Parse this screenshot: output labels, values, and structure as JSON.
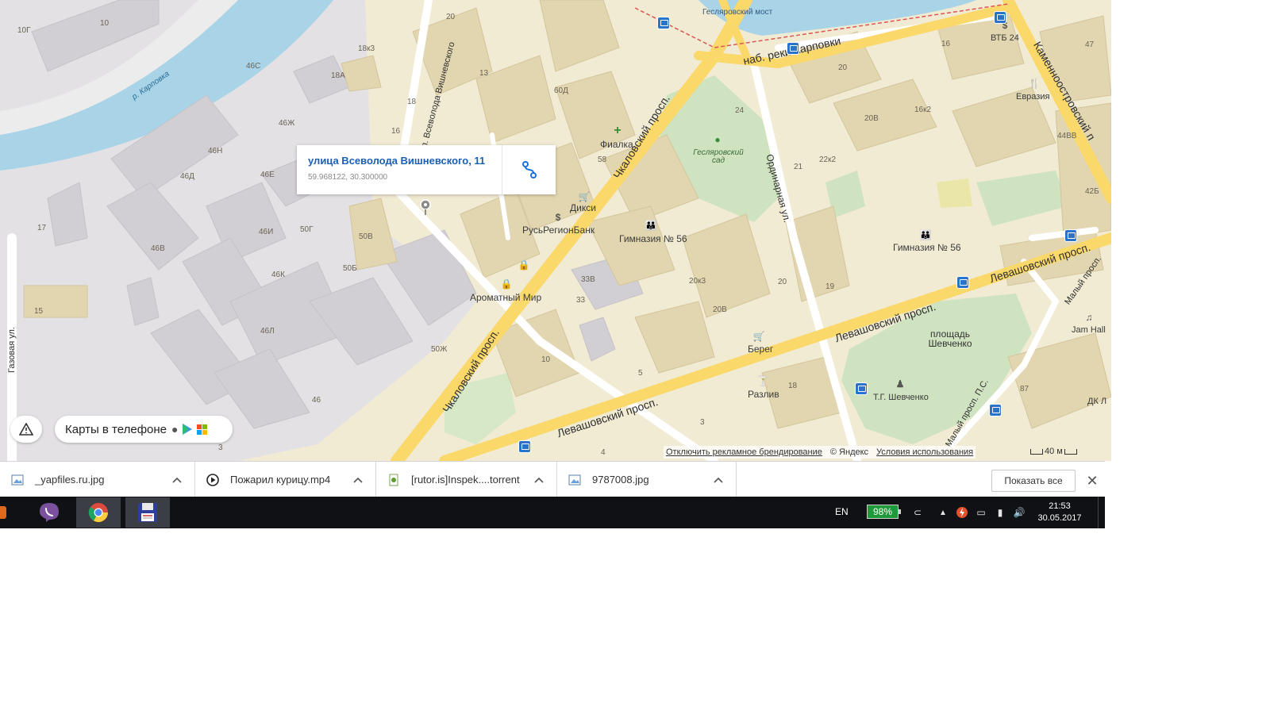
{
  "map": {
    "popup": {
      "address": "улица Всеволода Вишневского, 11",
      "coords": "59.968122, 30.300000"
    },
    "streets": [
      {
        "key": "karpovki",
        "text": "наб. реки Карповки"
      },
      {
        "key": "chkalov1",
        "text": "Чкаловский просп."
      },
      {
        "key": "chkalov2",
        "text": "Чкаловский просп."
      },
      {
        "key": "levash1",
        "text": "Левашовский просп."
      },
      {
        "key": "levash2",
        "text": "Левашовский просп."
      },
      {
        "key": "ordinar",
        "text": "Ординарная ул."
      },
      {
        "key": "kamennoostr",
        "text": "Каменноостровский п"
      },
      {
        "key": "vishnev",
        "text": "ул. Всеволода Вишневского"
      },
      {
        "key": "gazovaya",
        "text": "Газовая ул."
      },
      {
        "key": "maly",
        "text": "Малый просп."
      },
      {
        "key": "maly_ps",
        "text": "Малый просп. П.С."
      }
    ],
    "water": [
      {
        "key": "karpovka",
        "text": "р. Карповка"
      },
      {
        "key": "bridge",
        "text": "Гесляровский мост"
      }
    ],
    "parks": [
      {
        "key": "geslerovsky",
        "text": "Гесляровский сад"
      },
      {
        "key": "shevchenko",
        "text": "площадь Шевченко"
      }
    ],
    "pois": [
      {
        "key": "fialka",
        "text": "Фиалка"
      },
      {
        "key": "diksi",
        "text": "Дикси"
      },
      {
        "key": "rusregion",
        "text": "РусьРегионБанк"
      },
      {
        "key": "gym1",
        "text": "Гимназия № 56"
      },
      {
        "key": "gym2",
        "text": "Гимназия № 56"
      },
      {
        "key": "aromat",
        "text": "Ароматный Мир"
      },
      {
        "key": "vtb",
        "text": "ВТБ 24"
      },
      {
        "key": "evrazia",
        "text": "Евразия"
      },
      {
        "key": "bereg",
        "text": "Берег"
      },
      {
        "key": "razliv",
        "text": "Разлив"
      },
      {
        "key": "shevchenko_mon",
        "text": "Т.Г. Шевченко"
      },
      {
        "key": "jamhall",
        "text": "Jam Hall"
      },
      {
        "key": "dk",
        "text": "ДК Л"
      }
    ],
    "house_numbers": [
      "10Г",
      "10",
      "20",
      "13",
      "18к3",
      "46С",
      "18А",
      "60Д",
      "18",
      "16",
      "46Ж",
      "46Н",
      "46Д",
      "46Е",
      "58",
      "46И",
      "50Г",
      "50В",
      "50Б",
      "46К",
      "46В",
      "17",
      "15",
      "46Л",
      "50Ж",
      "33В",
      "33",
      "10",
      "20к3",
      "20В",
      "20",
      "5",
      "46",
      "3",
      "24",
      "22к2",
      "21",
      "20В",
      "16к2",
      "16",
      "20",
      "44ВВ",
      "42Б",
      "47",
      "19",
      "18",
      "87",
      "3",
      "4",
      "9"
    ],
    "controls": {
      "phone_label": "Карты в телефоне",
      "copyright_disable": "Отключить рекламное брендирование",
      "copyright_yandex": "© Яндекс",
      "copyright_terms": "Условия использования",
      "scale": "40 м"
    }
  },
  "downloads": {
    "items": [
      {
        "name": "_yapfiles.ru.jpg",
        "icon": "image-file-icon"
      },
      {
        "name": "Пожарил курицу.mp4",
        "icon": "video-file-icon"
      },
      {
        "name": "[rutor.is]Inspek....torrent",
        "icon": "torrent-file-icon"
      },
      {
        "name": "9787008.jpg",
        "icon": "image-file-icon"
      }
    ],
    "show_all": "Показать все",
    "close": "✕"
  },
  "taskbar": {
    "apps": [
      "viber",
      "chrome",
      "save-app"
    ],
    "language": "EN",
    "battery": "98%",
    "time": "21:53",
    "date": "30.05.2017"
  }
}
